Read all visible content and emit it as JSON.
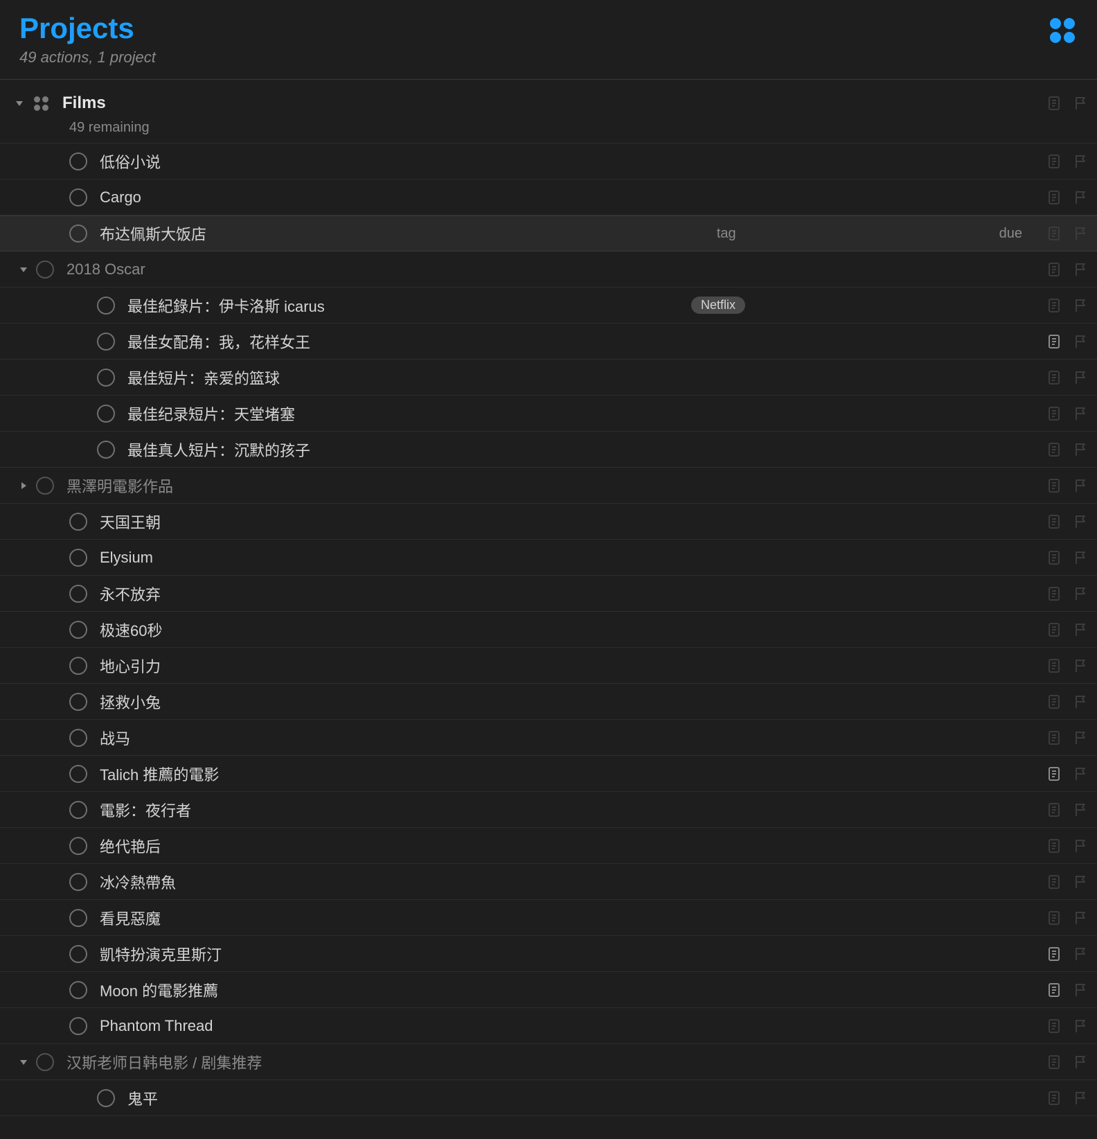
{
  "header": {
    "title": "Projects",
    "subtitle": "49 actions, 1 project"
  },
  "columns": {
    "tag": "tag",
    "due": "due"
  },
  "project": {
    "name": "Films",
    "remaining": "49 remaining"
  },
  "tags": {
    "netflix": "Netflix"
  },
  "items": [
    {
      "title": "低俗小说"
    },
    {
      "title": "Cargo"
    },
    {
      "title": "布达佩斯大饭店",
      "selected": true
    },
    {
      "title": "2018 Oscar",
      "group": true,
      "expanded": true,
      "dim": true
    },
    {
      "title": "最佳紀錄片：伊卡洛斯 icarus",
      "child": true,
      "tag": "netflix"
    },
    {
      "title": "最佳女配角：我，花样女王",
      "child": true,
      "note": true
    },
    {
      "title": "最佳短片：亲爱的篮球",
      "child": true
    },
    {
      "title": "最佳纪录短片：天堂堵塞",
      "child": true
    },
    {
      "title": "最佳真人短片：沉默的孩子",
      "child": true
    },
    {
      "title": "黑澤明電影作品",
      "group": true,
      "expanded": false,
      "dim": true
    },
    {
      "title": "天国王朝"
    },
    {
      "title": "Elysium"
    },
    {
      "title": "永不放弃"
    },
    {
      "title": "极速60秒"
    },
    {
      "title": "地心引力"
    },
    {
      "title": "拯救小兔"
    },
    {
      "title": "战马"
    },
    {
      "title": "Talich 推薦的電影",
      "note": true
    },
    {
      "title": "電影：夜行者"
    },
    {
      "title": "绝代艳后"
    },
    {
      "title": "冰冷熱帶魚"
    },
    {
      "title": "看見惡魔"
    },
    {
      "title": "凱特扮演克里斯汀",
      "note": true
    },
    {
      "title": "Moon 的電影推薦",
      "note": true
    },
    {
      "title": "Phantom Thread"
    },
    {
      "title": "汉斯老师日韩电影 / 剧集推荐",
      "group": true,
      "expanded": true,
      "dim": true
    },
    {
      "title": "鬼平",
      "child": true
    }
  ]
}
